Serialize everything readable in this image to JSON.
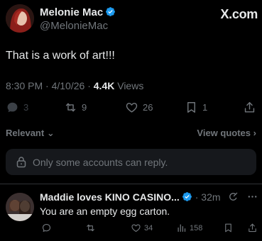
{
  "post": {
    "author_name": "Melonie Mac",
    "author_handle": "@MelonieMac",
    "brand": "X.com",
    "text": "That is a work of art!!!",
    "time": "8:30 PM",
    "date": "4/10/26",
    "views_count": "4.4K",
    "views_label": "Views",
    "replies": "3",
    "reposts": "9",
    "likes": "26",
    "bookmarks": "1"
  },
  "sort": {
    "relevant_label": "Relevant",
    "view_quotes_label": "View quotes"
  },
  "notice": {
    "text": "Only some accounts can reply."
  },
  "reply": {
    "author_name": "Maddie loves KINO CASINO...",
    "time": "32m",
    "text": "You are an empty egg carton.",
    "likes": "34",
    "views": "158"
  },
  "colors": {
    "background": "#000000",
    "text": "#e7e9ea",
    "muted": "#71767b",
    "verified": "#1d9bf0",
    "notice_bg": "#16181c"
  }
}
